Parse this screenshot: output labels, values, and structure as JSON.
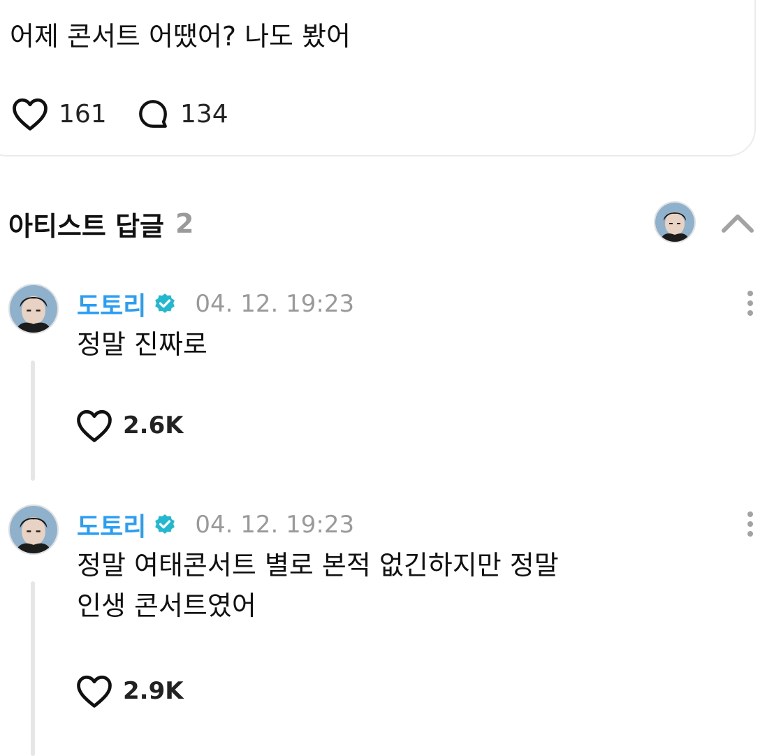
{
  "post": {
    "text": "어제 콘서트 어땠어? 나도 봤어",
    "likes": "161",
    "comments": "134"
  },
  "section": {
    "title": "아티스트 답글",
    "count": "2"
  },
  "replies": [
    {
      "name": "도토리",
      "time": "04. 12. 19:23",
      "lines": [
        "정말 진짜로"
      ],
      "likes": "2.6K"
    },
    {
      "name": "도토리",
      "time": "04. 12. 19:23",
      "lines": [
        "정말 여태콘서트 별로 본적 없긴하지만 정말",
        "인생 콘서트였어"
      ],
      "likes": "2.9K"
    }
  ],
  "colors": {
    "username": "#2a9df4",
    "verified_badge": "#22b8cf",
    "muted": "#9a9a9a"
  },
  "icons": {
    "like": "heart-icon",
    "comment": "comment-bubble-icon",
    "verified": "verified-badge-icon",
    "more": "more-vertical-icon",
    "collapse": "chevron-up-icon"
  }
}
